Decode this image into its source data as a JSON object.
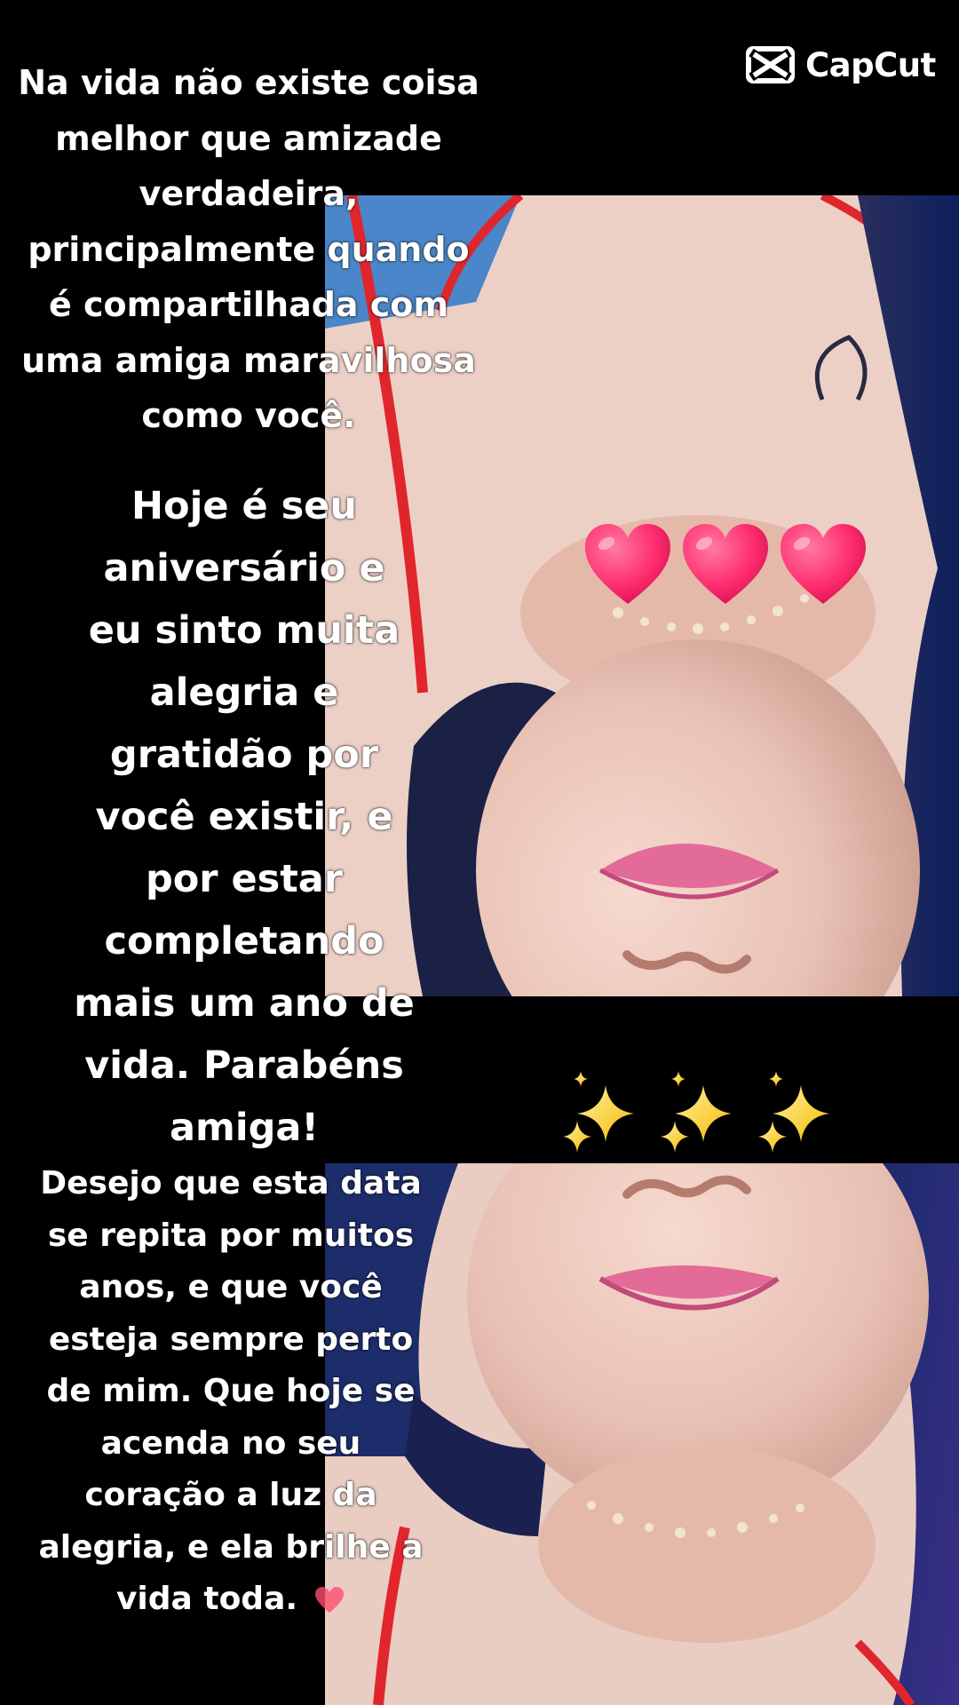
{
  "logo": {
    "text": "CapCut",
    "icon": "capcut-logo-icon"
  },
  "paragraphs": {
    "intro": "Na vida não existe coisa\nmelhor que amizade\nverdadeira,\nprincipalmente quando\né compartilhada com\numa amiga maravilhosa\ncomo você.",
    "birthday": "Hoje é seu\naniversário e\neu sinto muita\nalegria e\ngratidão por\nvocê existir, e\npor estar\ncompletando\nmais um ano de\nvida. Parabéns\namiga!",
    "wish": "Desejo que esta data\nse repita por muitos\nanos, e que você\nesteja sempre perto\nde mim. Que hoje se\nacenda no seu\ncoração a luz da\nalegria, e ela brilhe a\nvida toda."
  },
  "decorations": {
    "hearts": {
      "count": 3,
      "icon": "heart-icon",
      "color": "#ff2d6f"
    },
    "sparkles": {
      "count": 3,
      "icon": "sparkles-icon",
      "color": "#ffd43b"
    },
    "trailing_heart": {
      "icon": "small-heart-icon",
      "color": "#ff4d6d"
    }
  },
  "colors": {
    "background": "#000000",
    "text": "#ffffff",
    "photo_skin": "#e7c2b6",
    "photo_hair": "#1d3a78",
    "photo_outfit_red": "#e0262c",
    "photo_lips": "#e05a8c"
  }
}
